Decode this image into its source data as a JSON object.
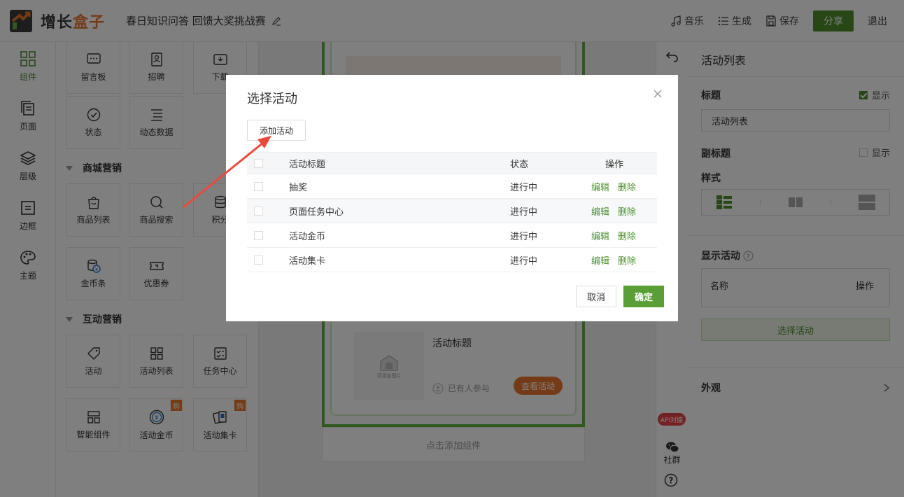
{
  "header": {
    "logo_a": "增长",
    "logo_b": "盒子",
    "app_title": "春日知识问答 回馈大奖挑战赛",
    "music": "音乐",
    "generate": "生成",
    "save": "保存",
    "share": "分享",
    "exit": "退出"
  },
  "leftnav": {
    "items": [
      {
        "label": "组件",
        "icon": "grid-icon"
      },
      {
        "label": "页面",
        "icon": "pages-icon"
      },
      {
        "label": "层级",
        "icon": "layers-icon"
      },
      {
        "label": "边框",
        "icon": "border-icon"
      },
      {
        "label": "主题",
        "icon": "palette-icon"
      }
    ]
  },
  "components": {
    "row1": [
      "留言板",
      "招聘",
      "下载"
    ],
    "row2": [
      "状态",
      "动态数据"
    ],
    "section_mall": "商城营销",
    "row3": [
      "商品列表",
      "商品搜索",
      "积分"
    ],
    "row4": [
      "金币条",
      "优惠券"
    ],
    "section_interact": "互动营销",
    "row5": [
      "活动",
      "活动列表",
      "任务中心"
    ],
    "row6": [
      "智能组件",
      "活动金币",
      "活动集卡"
    ],
    "badge": "购"
  },
  "canvas": {
    "activity_title": "活动标题",
    "image_placeholder": "请添加图片",
    "participants": "已有人参与",
    "view_button": "查看活动",
    "add_component": "点击添加组件"
  },
  "toolcol": {
    "api_badge": "API对接",
    "community": "社群"
  },
  "rpanel": {
    "title": "活动列表",
    "label_title": "标题",
    "show": "显示",
    "title_value": "活动列表",
    "label_subtitle": "副标题",
    "label_style": "样式",
    "label_show_activity": "显示活动",
    "col_name": "名称",
    "col_ops": "操作",
    "choose_button": "选择活动",
    "appearance": "外观"
  },
  "modal": {
    "title": "选择活动",
    "add_button": "添加活动",
    "columns": {
      "title": "活动标题",
      "status": "状态",
      "ops": "操作"
    },
    "rows": [
      {
        "title": "抽奖",
        "status": "进行中",
        "edit": "编辑",
        "delete": "删除"
      },
      {
        "title": "页面任务中心",
        "status": "进行中",
        "edit": "编辑",
        "delete": "删除"
      },
      {
        "title": "活动金币",
        "status": "进行中",
        "edit": "编辑",
        "delete": "删除"
      },
      {
        "title": "活动集卡",
        "status": "进行中",
        "edit": "编辑",
        "delete": "删除"
      }
    ],
    "cancel": "取消",
    "confirm": "确定"
  },
  "colors": {
    "brand_green": "#4f8f2f",
    "accent_orange": "#e8762d",
    "annotation_red": "#e84b3c"
  }
}
